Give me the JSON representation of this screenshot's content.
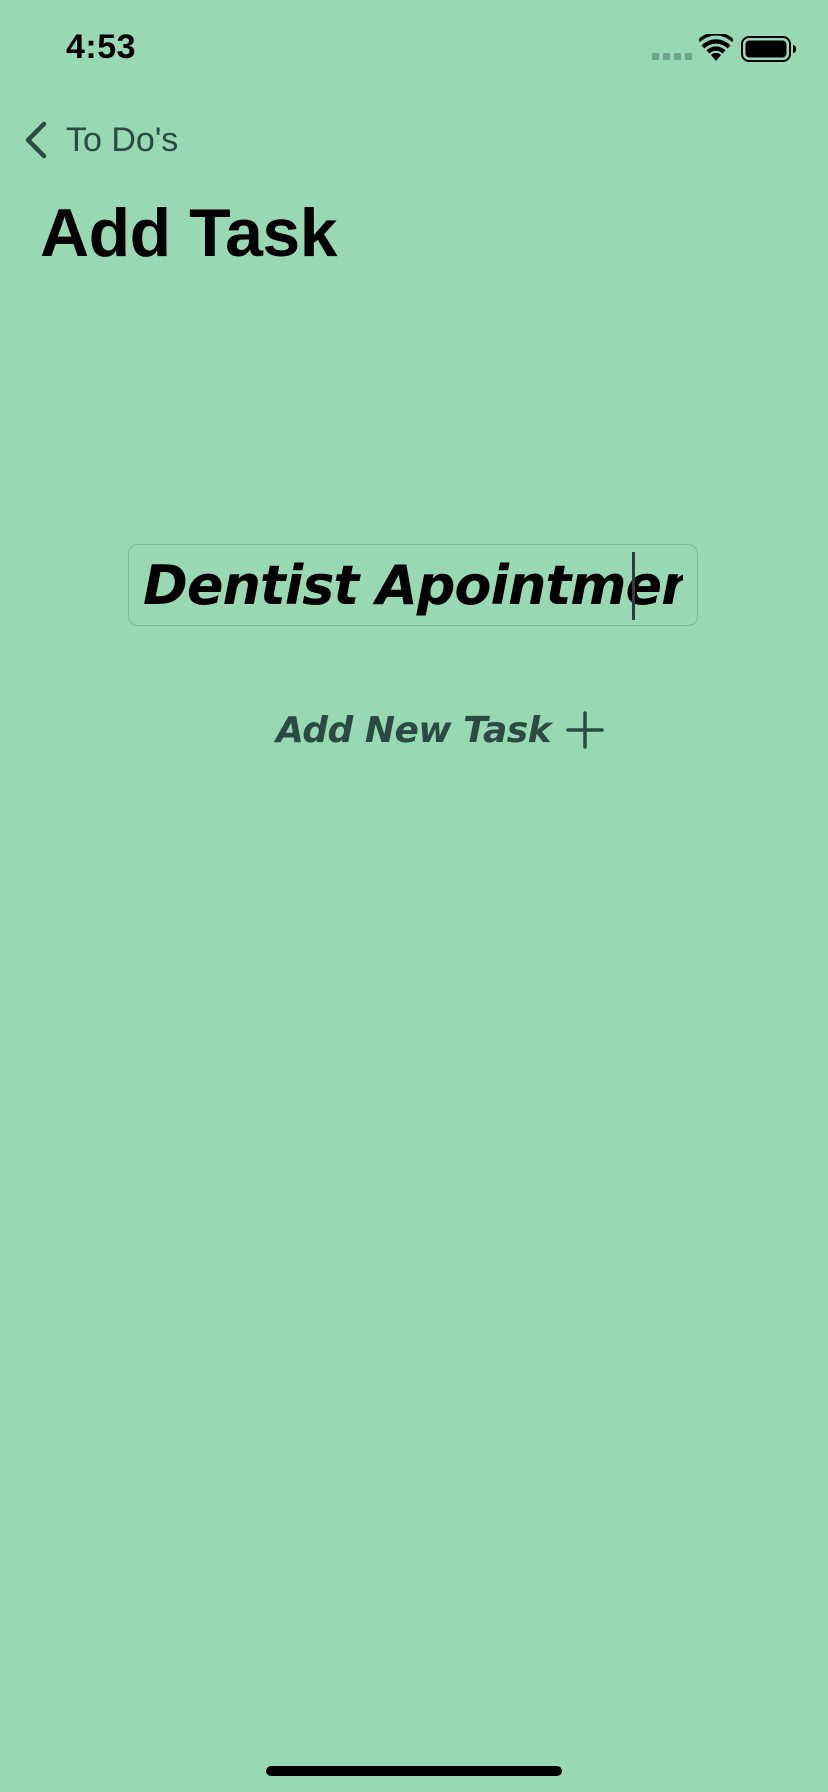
{
  "status_bar": {
    "time": "4:53",
    "signal_icon": "cellular-signal-icon",
    "wifi_icon": "wifi-icon",
    "battery_icon": "battery-icon"
  },
  "nav": {
    "back_icon": "chevron-left-icon",
    "back_label": "To Do's"
  },
  "page": {
    "title": "Add Task"
  },
  "task_input": {
    "value": "Dentist Apointment",
    "placeholder": ""
  },
  "actions": {
    "add_label": "Add New Task",
    "add_icon": "plus-icon"
  },
  "colors": {
    "background": "#98d8b2",
    "accent": "#2a4a42",
    "text": "#000000"
  }
}
